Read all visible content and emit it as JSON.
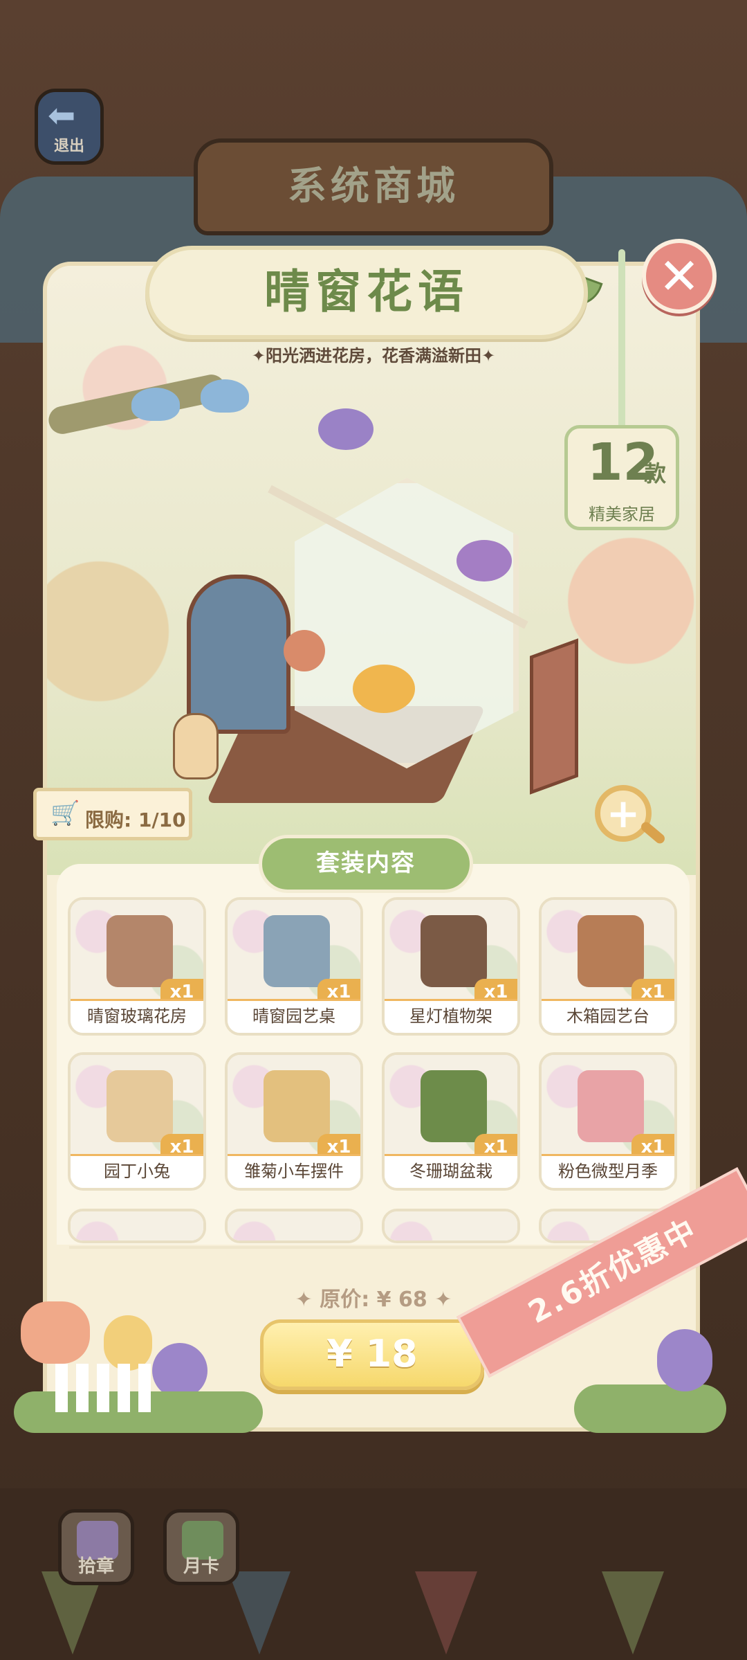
{
  "header": {
    "exit_label": "退出",
    "store_title": "系统商城"
  },
  "bundle": {
    "title": "晴窗花语",
    "subtitle": "✦阳光洒进花房，花香满溢新田✦",
    "count_number": "12",
    "count_unit": "款",
    "count_desc": "精美家居",
    "limit_text": "限购: 1/10",
    "section_label": "套装内容"
  },
  "items": [
    {
      "name": "晴窗玻璃花房",
      "qty": "x1",
      "color": "#b4866a"
    },
    {
      "name": "晴窗园艺桌",
      "qty": "x1",
      "color": "#8aa3b6"
    },
    {
      "name": "星灯植物架",
      "qty": "x1",
      "color": "#7b5a45"
    },
    {
      "name": "木箱园艺台",
      "qty": "x1",
      "color": "#b77d56"
    },
    {
      "name": "园丁小兔",
      "qty": "x1",
      "color": "#e6c99a"
    },
    {
      "name": "雏菊小车摆件",
      "qty": "x1",
      "color": "#e3c07e"
    },
    {
      "name": "冬珊瑚盆栽",
      "qty": "x1",
      "color": "#6d8c4a"
    },
    {
      "name": "粉色微型月季",
      "qty": "x1",
      "color": "#e8a3a6"
    }
  ],
  "pricing": {
    "original_price": "✦ 原价: ¥ 68 ✦",
    "price": "¥ 18",
    "discount_label": "2.6折优惠中"
  },
  "bottom_buttons": {
    "left_label": "拾章",
    "right_label": "月卡"
  },
  "colors": {
    "accent_green": "#6d8a4a",
    "price_yellow": "#f6d86c",
    "discount_pink": "#ef9d96",
    "close_red": "#e58b82"
  }
}
